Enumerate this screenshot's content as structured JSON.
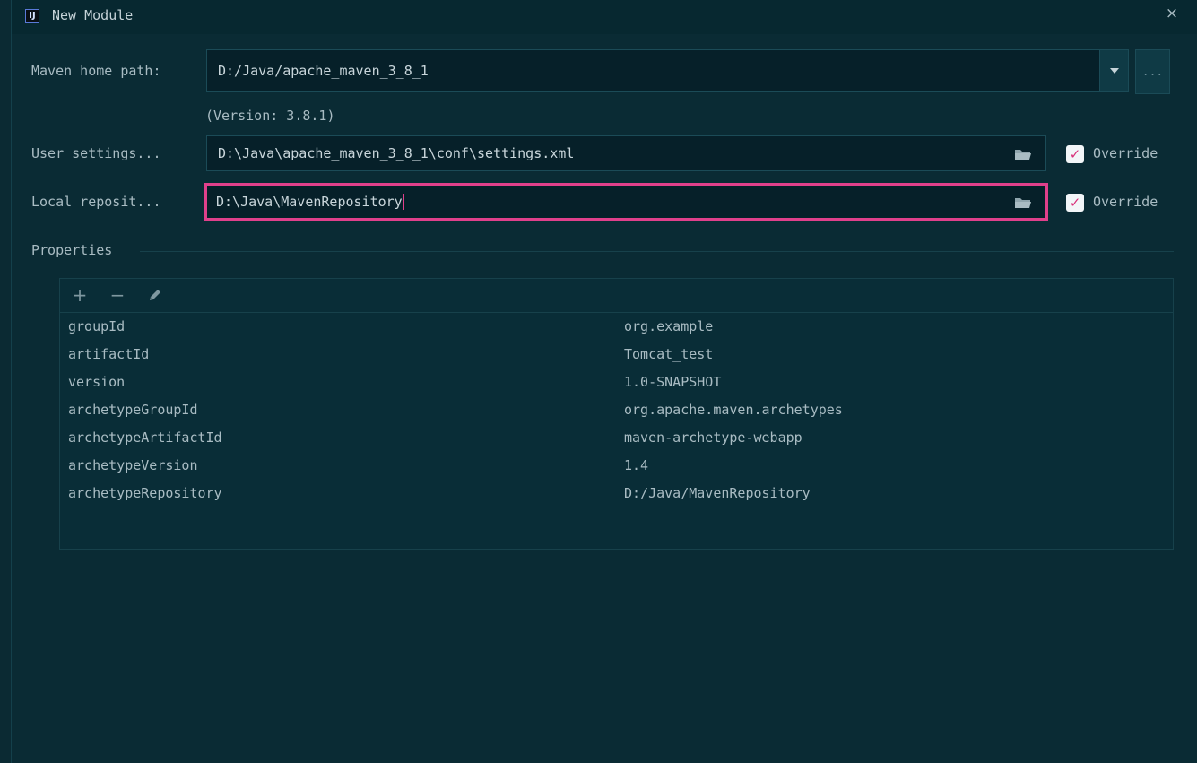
{
  "window": {
    "title": "New Module",
    "app_icon_text": "IJ",
    "close_glyph": "×"
  },
  "maven_home": {
    "label": "Maven home path:",
    "value": "D:/Java/apache_maven_3_8_1",
    "version": "(Version: 3.8.1)",
    "browse_label": "..."
  },
  "user_settings": {
    "label": "User settings...",
    "value": "D:\\Java\\apache_maven_3_8_1\\conf\\settings.xml",
    "override_label": "Override",
    "override_checked": true
  },
  "local_repository": {
    "label": "Local reposit...",
    "value": "D:\\Java\\MavenRepository",
    "override_label": "Override",
    "override_checked": true,
    "focus_color": "#e0408b"
  },
  "properties": {
    "title": "Properties",
    "toolbar": {
      "add": "+",
      "remove": "−",
      "edit_icon": "pencil-icon"
    },
    "rows": [
      {
        "key": "groupId",
        "value": "org.example"
      },
      {
        "key": "artifactId",
        "value": "Tomcat_test"
      },
      {
        "key": "version",
        "value": "1.0-SNAPSHOT"
      },
      {
        "key": "archetypeGroupId",
        "value": "org.apache.maven.archetypes"
      },
      {
        "key": "archetypeArtifactId",
        "value": "maven-archetype-webapp"
      },
      {
        "key": "archetypeVersion",
        "value": "1.4"
      },
      {
        "key": "archetypeRepository",
        "value": "D:/Java/MavenRepository"
      }
    ]
  },
  "colors": {
    "background": "#0a2b34",
    "checkbox_check": "#d8327a"
  }
}
